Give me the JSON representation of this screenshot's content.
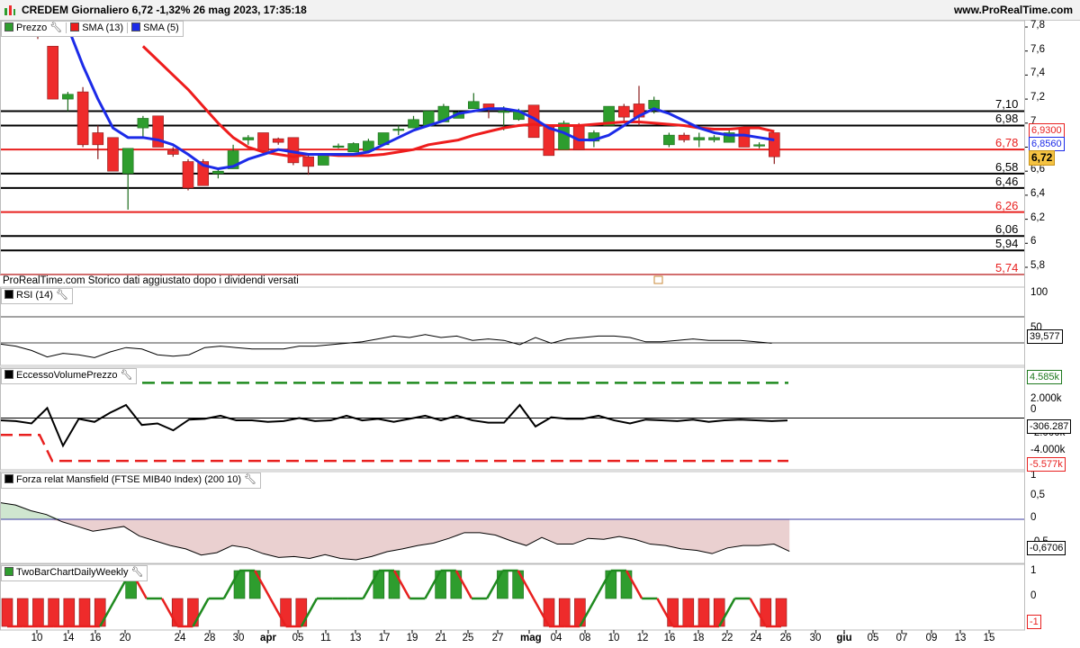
{
  "header": {
    "title": "CREDEM Giornaliero 6,72  -1,32% 26 mag 2023, 17:35:18",
    "site": "www.ProRealTime.com"
  },
  "colors": {
    "up": "#2e9d2e",
    "down": "#ee2b2b",
    "sma13": "#ee1c1c",
    "sma5": "#1c2be8",
    "hline_black": "#000000",
    "hline_red": "#e8201f",
    "fill_green": "#cfe6cf",
    "fill_red": "#ead0d0"
  },
  "price_panel": {
    "legend": {
      "price": "Prezzo",
      "sma13": "SMA (13)",
      "sma5": "SMA (5)"
    },
    "footer": "ProRealTime.com  Storico dati aggiustato dopo i dividendi versati",
    "hlevels": [
      {
        "label": "7,10",
        "value": 7.1,
        "color": "black"
      },
      {
        "label": "6,98",
        "value": 6.98,
        "color": "black"
      },
      {
        "label": "6,78",
        "value": 6.78,
        "color": "red"
      },
      {
        "label": "6,58",
        "value": 6.58,
        "color": "black"
      },
      {
        "label": "6,46",
        "value": 6.46,
        "color": "black"
      },
      {
        "label": "6,26",
        "value": 6.26,
        "color": "red"
      },
      {
        "label": "6,06",
        "value": 6.06,
        "color": "black"
      },
      {
        "label": "5,94",
        "value": 5.94,
        "color": "black"
      },
      {
        "label": "5,74",
        "value": 5.74,
        "color": "red"
      }
    ],
    "yticks": [
      "7,8",
      "7,6",
      "7,4",
      "7,2",
      "7",
      "6,8",
      "6,6",
      "6,4",
      "6,2",
      "6",
      "5,8"
    ],
    "tags": {
      "sma13": "6,9300",
      "sma5": "6,8560",
      "last": "6,72"
    }
  },
  "rsi_panel": {
    "legend": "RSI (14)",
    "yticks": [
      "100",
      "50"
    ],
    "value_tag": "39,577"
  },
  "evp_panel": {
    "legend": "EccessoVolumePrezzo",
    "yticks": [
      "2.000k",
      "0",
      "-2.000k",
      "-4.000k"
    ],
    "tags": {
      "upper": "4.585k",
      "value": "-306.287",
      "lower": "-5.577k"
    }
  },
  "mansfield_panel": {
    "legend": "Forza relat Mansfield (FTSE MIB40 Index) (200 10)",
    "yticks": [
      "1",
      "0,5",
      "0",
      "-0,5"
    ],
    "value_tag": "-0,6706"
  },
  "twobar_panel": {
    "legend": "TwoBarChartDailyWeekly",
    "yticks": [
      "1",
      "0"
    ],
    "value_tag": "-1"
  },
  "xaxis": {
    "labels": [
      "10",
      "14",
      "16",
      "20",
      "24",
      "28",
      "30",
      "apr",
      "05",
      "11",
      "13",
      "17",
      "19",
      "21",
      "25",
      "27",
      "mag",
      "04",
      "08",
      "10",
      "12",
      "16",
      "18",
      "22",
      "24",
      "26",
      "30",
      "giu",
      "05",
      "07",
      "09",
      "13",
      "15"
    ]
  },
  "chart_data": {
    "type": "candlestick",
    "title": "CREDEM Giornaliero",
    "last_close": 6.72,
    "change_pct": -1.32,
    "ylim": [
      5.7,
      7.85
    ],
    "candles": [
      {
        "o": 7.75,
        "h": 7.8,
        "l": 7.7,
        "c": 7.72
      },
      {
        "o": 7.64,
        "h": 7.64,
        "l": 7.2,
        "c": 7.2
      },
      {
        "o": 7.2,
        "h": 7.26,
        "l": 7.1,
        "c": 7.24
      },
      {
        "o": 7.26,
        "h": 7.3,
        "l": 6.8,
        "c": 6.82
      },
      {
        "o": 6.92,
        "h": 6.98,
        "l": 6.7,
        "c": 6.82
      },
      {
        "o": 6.88,
        "h": 6.88,
        "l": 6.6,
        "c": 6.6
      },
      {
        "o": 6.58,
        "h": 6.79,
        "l": 6.28,
        "c": 6.79
      },
      {
        "o": 6.96,
        "h": 7.06,
        "l": 6.88,
        "c": 7.04
      },
      {
        "o": 7.06,
        "h": 7.06,
        "l": 6.8,
        "c": 6.8
      },
      {
        "o": 6.77,
        "h": 6.8,
        "l": 6.72,
        "c": 6.74
      },
      {
        "o": 6.68,
        "h": 6.7,
        "l": 6.44,
        "c": 6.46
      },
      {
        "o": 6.68,
        "h": 6.7,
        "l": 6.48,
        "c": 6.48
      },
      {
        "o": 6.58,
        "h": 6.62,
        "l": 6.54,
        "c": 6.6
      },
      {
        "o": 6.62,
        "h": 6.82,
        "l": 6.62,
        "c": 6.77
      },
      {
        "o": 6.86,
        "h": 6.9,
        "l": 6.82,
        "c": 6.88
      },
      {
        "o": 6.92,
        "h": 6.92,
        "l": 6.77,
        "c": 6.77
      },
      {
        "o": 6.87,
        "h": 6.88,
        "l": 6.82,
        "c": 6.84
      },
      {
        "o": 6.88,
        "h": 6.88,
        "l": 6.65,
        "c": 6.67
      },
      {
        "o": 6.72,
        "h": 6.74,
        "l": 6.57,
        "c": 6.64
      },
      {
        "o": 6.65,
        "h": 6.74,
        "l": 6.65,
        "c": 6.74
      },
      {
        "o": 6.8,
        "h": 6.83,
        "l": 6.79,
        "c": 6.81
      },
      {
        "o": 6.76,
        "h": 6.84,
        "l": 6.76,
        "c": 6.83
      },
      {
        "o": 6.77,
        "h": 6.87,
        "l": 6.77,
        "c": 6.85
      },
      {
        "o": 6.82,
        "h": 6.92,
        "l": 6.82,
        "c": 6.92
      },
      {
        "o": 6.94,
        "h": 6.98,
        "l": 6.9,
        "c": 6.95
      },
      {
        "o": 6.96,
        "h": 7.06,
        "l": 6.96,
        "c": 7.03
      },
      {
        "o": 6.98,
        "h": 7.1,
        "l": 6.98,
        "c": 7.1
      },
      {
        "o": 7.01,
        "h": 7.16,
        "l": 7.01,
        "c": 7.14
      },
      {
        "o": 7.04,
        "h": 7.1,
        "l": 7.04,
        "c": 7.09
      },
      {
        "o": 7.12,
        "h": 7.25,
        "l": 7.12,
        "c": 7.18
      },
      {
        "o": 7.16,
        "h": 7.16,
        "l": 7.04,
        "c": 7.12
      },
      {
        "o": 7.1,
        "h": 7.14,
        "l": 6.94,
        "c": 7.1
      },
      {
        "o": 7.03,
        "h": 7.12,
        "l": 7.02,
        "c": 7.1
      },
      {
        "o": 7.15,
        "h": 7.15,
        "l": 6.88,
        "c": 6.88
      },
      {
        "o": 6.98,
        "h": 6.98,
        "l": 6.73,
        "c": 6.73
      },
      {
        "o": 6.78,
        "h": 7.02,
        "l": 6.78,
        "c": 7.0
      },
      {
        "o": 6.98,
        "h": 7.0,
        "l": 6.78,
        "c": 6.78
      },
      {
        "o": 6.85,
        "h": 6.94,
        "l": 6.8,
        "c": 6.92
      },
      {
        "o": 6.98,
        "h": 7.14,
        "l": 6.98,
        "c": 7.14
      },
      {
        "o": 7.14,
        "h": 7.16,
        "l": 7.0,
        "c": 7.05
      },
      {
        "o": 7.16,
        "h": 7.31,
        "l": 6.98,
        "c": 7.05
      },
      {
        "o": 7.12,
        "h": 7.22,
        "l": 7.08,
        "c": 7.19
      },
      {
        "o": 6.82,
        "h": 6.92,
        "l": 6.8,
        "c": 6.9
      },
      {
        "o": 6.9,
        "h": 6.92,
        "l": 6.84,
        "c": 6.86
      },
      {
        "o": 6.86,
        "h": 6.92,
        "l": 6.8,
        "c": 6.88
      },
      {
        "o": 6.86,
        "h": 6.9,
        "l": 6.84,
        "c": 6.88
      },
      {
        "o": 6.84,
        "h": 6.94,
        "l": 6.84,
        "c": 6.92
      },
      {
        "o": 6.96,
        "h": 6.96,
        "l": 6.8,
        "c": 6.8
      },
      {
        "o": 6.82,
        "h": 6.84,
        "l": 6.79,
        "c": 6.82
      },
      {
        "o": 6.92,
        "h": 6.92,
        "l": 6.66,
        "c": 6.72
      }
    ],
    "series": [
      {
        "name": "SMA (13)",
        "values": [
          {
            "i": 7,
            "v": 7.64
          },
          {
            "i": 8,
            "v": 7.52
          },
          {
            "i": 9,
            "v": 7.4
          },
          {
            "i": 10,
            "v": 7.28
          },
          {
            "i": 11,
            "v": 7.14
          },
          {
            "i": 12,
            "v": 7.0
          },
          {
            "i": 13,
            "v": 6.88
          },
          {
            "i": 14,
            "v": 6.8
          },
          {
            "i": 15,
            "v": 6.76
          },
          {
            "i": 16,
            "v": 6.74
          },
          {
            "i": 17,
            "v": 6.72
          },
          {
            "i": 18,
            "v": 6.74
          },
          {
            "i": 19,
            "v": 6.74
          },
          {
            "i": 20,
            "v": 6.73
          },
          {
            "i": 21,
            "v": 6.73
          },
          {
            "i": 22,
            "v": 6.73
          },
          {
            "i": 23,
            "v": 6.74
          },
          {
            "i": 24,
            "v": 6.76
          },
          {
            "i": 25,
            "v": 6.78
          },
          {
            "i": 26,
            "v": 6.82
          },
          {
            "i": 27,
            "v": 6.84
          },
          {
            "i": 28,
            "v": 6.86
          },
          {
            "i": 29,
            "v": 6.9
          },
          {
            "i": 30,
            "v": 6.93
          },
          {
            "i": 31,
            "v": 6.96
          },
          {
            "i": 32,
            "v": 6.98
          },
          {
            "i": 33,
            "v": 6.99
          },
          {
            "i": 34,
            "v": 6.98
          },
          {
            "i": 35,
            "v": 6.98
          },
          {
            "i": 36,
            "v": 6.98
          },
          {
            "i": 37,
            "v": 6.99
          },
          {
            "i": 38,
            "v": 7.0
          },
          {
            "i": 39,
            "v": 7.01
          },
          {
            "i": 40,
            "v": 7.01
          },
          {
            "i": 41,
            "v": 7.0
          },
          {
            "i": 42,
            "v": 6.99
          },
          {
            "i": 43,
            "v": 6.98
          },
          {
            "i": 44,
            "v": 6.96
          },
          {
            "i": 45,
            "v": 6.95
          },
          {
            "i": 46,
            "v": 6.95
          },
          {
            "i": 47,
            "v": 6.96
          },
          {
            "i": 48,
            "v": 6.96
          },
          {
            "i": 49,
            "v": 6.93
          }
        ]
      },
      {
        "name": "SMA (5)",
        "values": [
          {
            "i": 2,
            "v": 7.8
          },
          {
            "i": 3,
            "v": 7.48
          },
          {
            "i": 4,
            "v": 7.2
          },
          {
            "i": 5,
            "v": 6.96
          },
          {
            "i": 6,
            "v": 6.88
          },
          {
            "i": 7,
            "v": 6.88
          },
          {
            "i": 8,
            "v": 6.86
          },
          {
            "i": 9,
            "v": 6.82
          },
          {
            "i": 10,
            "v": 6.74
          },
          {
            "i": 11,
            "v": 6.65
          },
          {
            "i": 12,
            "v": 6.62
          },
          {
            "i": 13,
            "v": 6.64
          },
          {
            "i": 14,
            "v": 6.7
          },
          {
            "i": 15,
            "v": 6.74
          },
          {
            "i": 16,
            "v": 6.78
          },
          {
            "i": 17,
            "v": 6.76
          },
          {
            "i": 18,
            "v": 6.74
          },
          {
            "i": 19,
            "v": 6.74
          },
          {
            "i": 20,
            "v": 6.74
          },
          {
            "i": 21,
            "v": 6.74
          },
          {
            "i": 22,
            "v": 6.76
          },
          {
            "i": 23,
            "v": 6.82
          },
          {
            "i": 24,
            "v": 6.88
          },
          {
            "i": 25,
            "v": 6.94
          },
          {
            "i": 26,
            "v": 6.98
          },
          {
            "i": 27,
            "v": 7.02
          },
          {
            "i": 28,
            "v": 7.08
          },
          {
            "i": 29,
            "v": 7.1
          },
          {
            "i": 30,
            "v": 7.12
          },
          {
            "i": 31,
            "v": 7.12
          },
          {
            "i": 32,
            "v": 7.1
          },
          {
            "i": 33,
            "v": 7.04
          },
          {
            "i": 34,
            "v": 6.96
          },
          {
            "i": 35,
            "v": 6.92
          },
          {
            "i": 36,
            "v": 6.86
          },
          {
            "i": 37,
            "v": 6.86
          },
          {
            "i": 38,
            "v": 6.9
          },
          {
            "i": 39,
            "v": 6.98
          },
          {
            "i": 40,
            "v": 7.06
          },
          {
            "i": 41,
            "v": 7.12
          },
          {
            "i": 42,
            "v": 7.08
          },
          {
            "i": 43,
            "v": 7.02
          },
          {
            "i": 44,
            "v": 6.96
          },
          {
            "i": 45,
            "v": 6.92
          },
          {
            "i": 46,
            "v": 6.9
          },
          {
            "i": 47,
            "v": 6.9
          },
          {
            "i": 48,
            "v": 6.88
          },
          {
            "i": 49,
            "v": 6.86
          }
        ]
      }
    ],
    "rsi": {
      "ylim": [
        0,
        100
      ],
      "level": 50,
      "values": [
        31,
        28,
        22,
        13,
        18,
        16,
        12,
        20,
        26,
        24,
        16,
        14,
        16,
        26,
        28,
        26,
        24,
        24,
        24,
        28,
        28,
        30,
        32,
        34,
        38,
        42,
        40,
        44,
        40,
        42,
        36,
        38,
        36,
        30,
        40,
        32,
        38,
        40,
        42,
        42,
        40,
        34,
        34,
        36,
        38,
        36,
        36,
        36,
        34,
        32
      ]
    },
    "evp": {
      "upper": 4585,
      "lower": -5577,
      "lower_left": -2200,
      "values": [
        -300,
        -400,
        -700,
        1300,
        -3600,
        -100,
        -500,
        700,
        1700,
        -900,
        -700,
        -1600,
        -200,
        -100,
        300,
        -300,
        -300,
        -500,
        -400,
        0,
        -400,
        -300,
        300,
        -300,
        -100,
        -500,
        -100,
        300,
        -300,
        300,
        -300,
        -600,
        -600,
        1700,
        -1100,
        100,
        -100,
        -100,
        300,
        -300,
        -700,
        -200,
        -300,
        -400,
        -200,
        -500,
        -300,
        -200,
        -300,
        -400,
        -306
      ]
    },
    "mansfield": {
      "ylim": [
        -1,
        1
      ],
      "values": [
        0.35,
        0.3,
        0.18,
        0.1,
        -0.05,
        -0.15,
        -0.25,
        -0.2,
        -0.15,
        -0.35,
        -0.45,
        -0.55,
        -0.62,
        -0.75,
        -0.7,
        -0.55,
        -0.6,
        -0.72,
        -0.8,
        -0.78,
        -0.82,
        -0.74,
        -0.82,
        -0.85,
        -0.78,
        -0.68,
        -0.62,
        -0.55,
        -0.5,
        -0.4,
        -0.28,
        -0.28,
        -0.33,
        -0.45,
        -0.55,
        -0.38,
        -0.52,
        -0.52,
        -0.4,
        -0.42,
        -0.36,
        -0.42,
        -0.52,
        -0.55,
        -0.62,
        -0.65,
        -0.72,
        -0.6,
        -0.55,
        -0.55,
        -0.52,
        -0.6706
      ]
    },
    "twobar": {
      "ylim": [
        -1,
        1
      ],
      "values": [
        -1,
        -1,
        -1,
        -1,
        -1,
        -1,
        -1,
        0,
        1,
        0,
        0,
        -1,
        -1,
        0,
        0,
        1,
        1,
        0,
        -1,
        -1,
        0,
        0,
        0,
        0,
        1,
        1,
        0,
        0,
        1,
        1,
        0,
        0,
        1,
        1,
        0,
        -1,
        -1,
        -1,
        0,
        1,
        1,
        0,
        0,
        -1,
        -1,
        -1,
        -1,
        0,
        0,
        -1,
        -1
      ]
    },
    "xlabels": [
      "10",
      "14",
      "16",
      "20",
      "24",
      "28",
      "30",
      "apr",
      "05",
      "11",
      "13",
      "17",
      "19",
      "21",
      "25",
      "27",
      "mag",
      "04",
      "08",
      "10",
      "12",
      "16",
      "18",
      "22",
      "24",
      "26",
      "30",
      "giu",
      "05",
      "07",
      "09",
      "13",
      "15"
    ]
  }
}
